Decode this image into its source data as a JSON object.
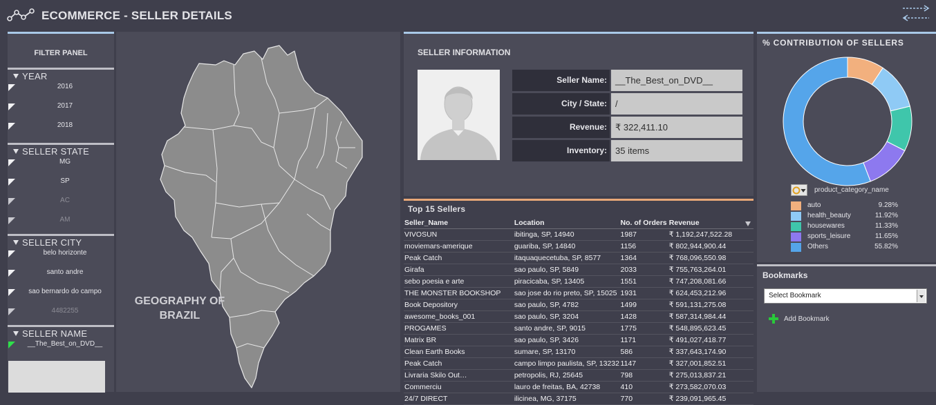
{
  "header": {
    "title": "ECOMMERCE - SELLER DETAILS"
  },
  "filter_panel": {
    "title": "FILTER PANEL",
    "sections": [
      {
        "label": "YEAR",
        "items": [
          {
            "label": "2016",
            "state": "possible"
          },
          {
            "label": "2017",
            "state": "possible"
          },
          {
            "label": "2018",
            "state": "possible"
          }
        ]
      },
      {
        "label": "SELLER STATE",
        "items": [
          {
            "label": "MG",
            "state": "possible"
          },
          {
            "label": "SP",
            "state": "possible"
          },
          {
            "label": "AC",
            "state": "excluded"
          },
          {
            "label": "AM",
            "state": "excluded"
          }
        ]
      },
      {
        "label": "SELLER CITY",
        "items": [
          {
            "label": "belo horizonte",
            "state": "possible"
          },
          {
            "label": "santo andre",
            "state": "possible"
          },
          {
            "label": "sao bernardo do campo",
            "state": "possible"
          },
          {
            "label": "4482255",
            "state": "excluded"
          }
        ]
      },
      {
        "label": "SELLER NAME",
        "items": [
          {
            "label": "__The_Best_on_DVD__",
            "state": "selected"
          }
        ]
      }
    ]
  },
  "map": {
    "caption_line1": "GEOGRAPHY OF",
    "caption_line2": "BRAZIL"
  },
  "seller_info": {
    "title": "SELLER INFORMATION",
    "rows": [
      {
        "key": "Seller Name:",
        "value": "__The_Best_on_DVD__"
      },
      {
        "key": "City / State:",
        "value": "/"
      },
      {
        "key": "Revenue:",
        "value": "₹ 322,411.10"
      },
      {
        "key": "Inventory:",
        "value": "35 items"
      }
    ]
  },
  "top_sellers": {
    "title": "Top 15 Sellers",
    "columns": [
      "Seller_Name",
      "Location",
      "No. of Orders",
      "Revenue"
    ],
    "rows": [
      [
        "VIVOSUN",
        "ibitinga, SP, 14940",
        "1987",
        "₹ 1,192,247,522.28"
      ],
      [
        "moviemars-amerique",
        "guariba, SP, 14840",
        "1156",
        "₹ 802,944,900.44"
      ],
      [
        "Peak Catch",
        "itaquaquecetuba, SP, 8577",
        "1364",
        "₹ 768,096,550.98"
      ],
      [
        "Girafa",
        "sao paulo, SP, 5849",
        "2033",
        "₹ 755,763,264.01"
      ],
      [
        "sebo poesia e arte",
        "piracicaba, SP, 13405",
        "1551",
        "₹ 747,208,081.66"
      ],
      [
        "THE MONSTER BOOKSHOP",
        "sao jose do rio preto, SP, 15025",
        "1931",
        "₹ 624,453,212.96"
      ],
      [
        "Book Depository",
        "sao paulo, SP, 4782",
        "1499",
        "₹ 591,131,275.08"
      ],
      [
        "awesome_books_001",
        "sao paulo, SP, 3204",
        "1428",
        "₹ 587,314,984.44"
      ],
      [
        "PROGAMES",
        "santo andre, SP, 9015",
        "1775",
        "₹ 548,895,623.45"
      ],
      [
        "Matrix BR",
        "sao paulo, SP, 3426",
        "1171",
        "₹ 491,027,418.77"
      ],
      [
        "Clean Earth Books",
        "sumare, SP, 13170",
        "586",
        "₹ 337,643,174.90"
      ],
      [
        "Peak Catch",
        "campo limpo paulista, SP, 13232",
        "1147",
        "₹ 327,001,852.51"
      ],
      [
        "Livraria Skilo Out…",
        "petropolis, RJ, 25645",
        "798",
        "₹ 275,013,837.21"
      ],
      [
        "Commerciu",
        "lauro de freitas, BA, 42738",
        "410",
        "₹ 273,582,070.03"
      ],
      [
        "24/7 DIRECT",
        "ilicinea, MG, 37175",
        "770",
        "₹ 239,091,965.45"
      ]
    ]
  },
  "contribution": {
    "title": "% CONTRIBUTION OF SELLERS",
    "dimension_label": "product_category_name",
    "chart_data": {
      "type": "pie",
      "categories": [
        "auto",
        "health_beauty",
        "housewares",
        "sports_leisure",
        "Others"
      ],
      "values": [
        9.28,
        11.92,
        11.33,
        11.65,
        55.82
      ],
      "labels": [
        "9.28%",
        "11.92%",
        "11.33%",
        "11.65%",
        "55.82%"
      ],
      "colors": [
        "#f2b07e",
        "#8fcaf5",
        "#3fc6ab",
        "#8d79ef",
        "#55a5ea"
      ],
      "title": "% CONTRIBUTION OF SELLERS"
    }
  },
  "bookmarks": {
    "title": "Bookmarks",
    "select_placeholder": "Select Bookmark",
    "add_label": "Add Bookmark"
  }
}
